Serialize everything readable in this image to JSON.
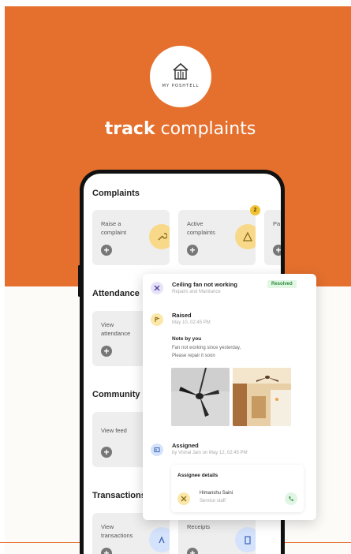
{
  "brand": {
    "name": "MY POSHTELL",
    "tagline_bold": "track",
    "tagline_rest": " complaints"
  },
  "app": {
    "sections": [
      {
        "title": "Complaints",
        "cards": [
          {
            "label": "Raise a complaint"
          },
          {
            "label": "Active complaints",
            "badge": "2"
          },
          {
            "label": "Pa co"
          }
        ]
      },
      {
        "title": "Attendance",
        "cards": [
          {
            "label": "View attendance"
          }
        ]
      },
      {
        "title": "Community",
        "cards": [
          {
            "label": "View feed"
          }
        ]
      },
      {
        "title": "Transactions",
        "cards": [
          {
            "label": "View transactions"
          },
          {
            "label": "Receipts"
          }
        ]
      }
    ]
  },
  "complaint_detail": {
    "title": "Ceiling fan not working",
    "category": "Repairs and Maintance",
    "status": "Resolved",
    "raised": {
      "title": "Raised",
      "time": "May 10, 02:45 PM",
      "note_heading": "Note by you",
      "note_line1": "Fan not working since yesterday,",
      "note_line2": "Please repair it soon"
    },
    "assigned": {
      "title": "Assigned",
      "meta": "by Vishal Jain on May 12, 02:45 PM",
      "details_heading": "Assignee details",
      "assignee_name": "Himanshu Saini",
      "assignee_role": "Service staff"
    }
  },
  "colors": {
    "brand_orange": "#e5702e",
    "yellow_circle": "#f8d98a",
    "blue_circle": "#d4e2fb",
    "resolved_green": "#2e8b3e"
  },
  "icons": {
    "logo": "building-icon",
    "complaint": "wrench-icon",
    "assigned": "id-card-icon",
    "call": "phone-icon"
  }
}
